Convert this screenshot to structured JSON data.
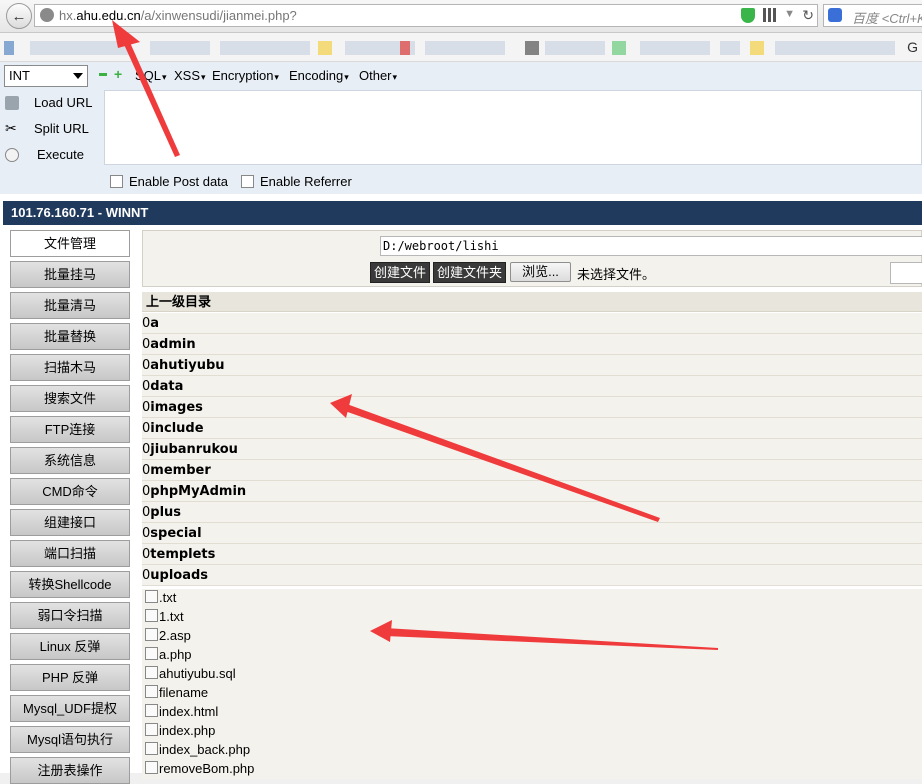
{
  "browser": {
    "url_prefix": "hx.",
    "url_domain": "ahu.edu.cn",
    "url_path": "/a/xinwensudi/jianmei.php?",
    "search_placeholder": "百度 <Ctrl+K>",
    "bookmark_tail": "G"
  },
  "hackbar": {
    "select_value": "INT",
    "menus": [
      "SQL",
      "XSS",
      "Encryption",
      "Encoding",
      "Other"
    ],
    "actions": [
      "Load URL",
      "Split URL",
      "Execute"
    ],
    "checkboxes": [
      "Enable Post data",
      "Enable Referrer"
    ]
  },
  "shell": {
    "title": "101.76.160.71 - WINNT",
    "nav": [
      "文件管理",
      "批量挂马",
      "批量清马",
      "批量替换",
      "扫描木马",
      "搜索文件",
      "FTP连接",
      "系统信息",
      "CMD命令",
      "组建接口",
      "端口扫描",
      "转换Shellcode",
      "弱口令扫描",
      "Linux 反弹",
      "PHP 反弹",
      "Mysql_UDF提权",
      "Mysql语句执行",
      "注册表操作"
    ],
    "path": "D:/webroot/lishi",
    "buttons": {
      "create_file": "创建文件",
      "create_folder": "创建文件夹",
      "browse": "浏览...",
      "no_file": "未选择文件。"
    },
    "list_header": "上一级目录",
    "folders": [
      {
        "num": "0",
        "name": "a"
      },
      {
        "num": "0",
        "name": "admin"
      },
      {
        "num": "0",
        "name": "ahutiyubu"
      },
      {
        "num": "0",
        "name": "data"
      },
      {
        "num": "0",
        "name": "images"
      },
      {
        "num": "0",
        "name": "include"
      },
      {
        "num": "0",
        "name": "jiubanrukou"
      },
      {
        "num": "0",
        "name": "member"
      },
      {
        "num": "0",
        "name": "phpMyAdmin"
      },
      {
        "num": "0",
        "name": "plus"
      },
      {
        "num": "0",
        "name": "special"
      },
      {
        "num": "0",
        "name": "templets"
      },
      {
        "num": "0",
        "name": "uploads"
      }
    ],
    "files": [
      ".txt",
      "1.txt",
      "2.asp",
      "a.php",
      "ahutiyubu.sql",
      "filename",
      "index.html",
      "index.php",
      "index_back.php",
      "removeBom.php"
    ]
  },
  "colors": {
    "title_bar": "#203a5e",
    "annotation_arrow": "#ef3b3b"
  }
}
